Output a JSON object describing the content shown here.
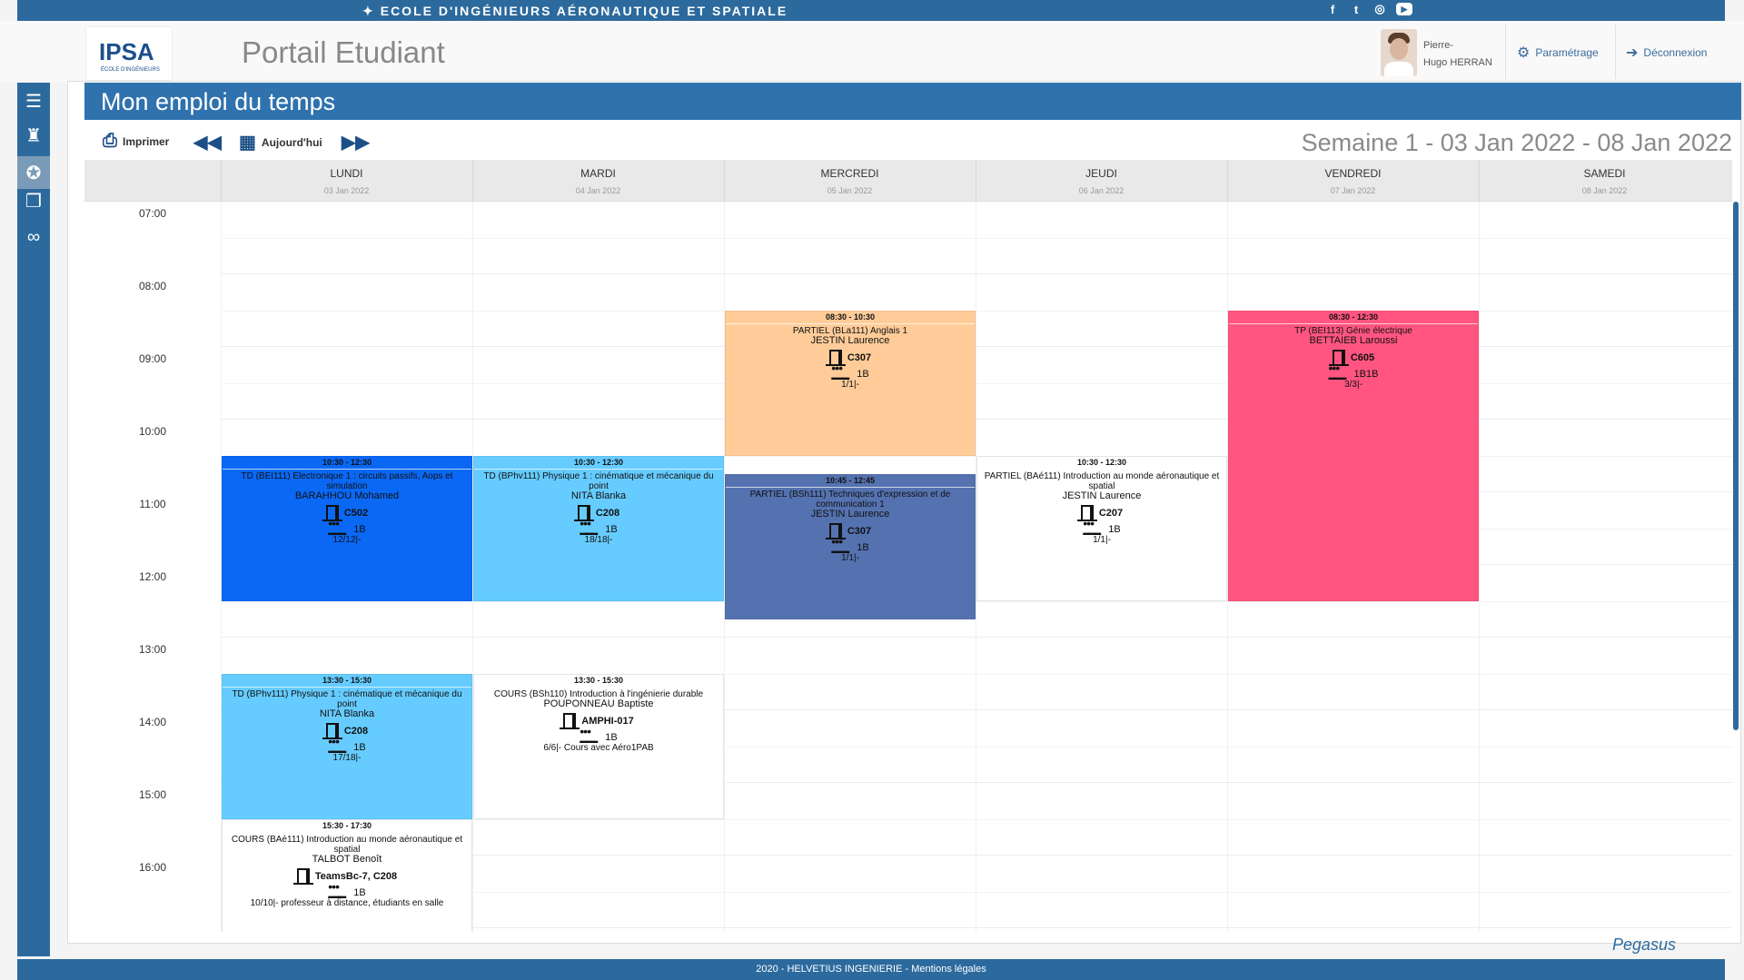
{
  "topbar": {
    "school_name": "ECOLE D'INGÉNIEURS AÉRONAUTIQUE ET SPATIALE",
    "social": [
      "f",
      "t",
      "ig",
      "yt"
    ]
  },
  "header": {
    "logo_text": "IPSA",
    "logo_sub": "ÉCOLE D'INGÉNIEURS",
    "portal_title": "Portail Etudiant",
    "user_first": "Pierre-",
    "user_last": "Hugo HERRAN",
    "settings_label": "Paramétrage",
    "logout_label": "Déconnexion"
  },
  "nav": {
    "icons": [
      "menu-icon",
      "graduate-icon",
      "certificate-icon",
      "documents-icon",
      "link-icon"
    ]
  },
  "page_title": "Mon emploi du temps",
  "toolbar": {
    "print_label": "Imprimer",
    "today_label": "Aujourd'hui",
    "week_title": "Semaine 1 - 03 Jan 2022 - 08 Jan 2022"
  },
  "days": [
    {
      "name": "LUNDI",
      "date": "03 Jan 2022"
    },
    {
      "name": "MARDI",
      "date": "04 Jan 2022"
    },
    {
      "name": "MERCREDI",
      "date": "05 Jan 2022"
    },
    {
      "name": "JEUDI",
      "date": "06 Jan 2022"
    },
    {
      "name": "VENDREDI",
      "date": "07 Jan 2022"
    },
    {
      "name": "SAMEDI",
      "date": "08 Jan 2022"
    }
  ],
  "hours": [
    "07:00",
    "08:00",
    "09:00",
    "10:00",
    "11:00",
    "12:00",
    "13:00",
    "14:00",
    "15:00",
    "16:00"
  ],
  "events": [
    {
      "day": 0,
      "start": 10.5,
      "end": 12.5,
      "color": "#0a68f5",
      "time": "10:30 - 12:30",
      "title": "TD (BEI111) Electronique 1 : circuits passifs, Aops et simulation",
      "teacher": "BARAHHOU Mohamed",
      "room": "C502",
      "group": "1B",
      "count": "12/12|-"
    },
    {
      "day": 1,
      "start": 10.5,
      "end": 12.5,
      "color": "#66ccff",
      "time": "10:30 - 12:30",
      "title": "TD (BPhv111) Physique 1 : cinématique et mécanique du point",
      "teacher": "NITA Blanka",
      "room": "C208",
      "group": "1B",
      "count": "18/18|-"
    },
    {
      "day": 2,
      "start": 8.5,
      "end": 10.5,
      "color": "#ffcc99",
      "time": "08:30 - 10:30",
      "title": "PARTIEL (BLa111) Anglais 1",
      "teacher": "JESTIN Laurence",
      "room": "C307",
      "group": "1B",
      "count": "1/1|-"
    },
    {
      "day": 2,
      "start": 10.75,
      "end": 12.75,
      "color": "#5572b0",
      "time": "10:45 - 12:45",
      "title": "PARTIEL (BSh111) Techniques d'expression et de communication 1",
      "teacher": "JESTIN Laurence",
      "room": "C307",
      "group": "1B",
      "count": "1/1|-"
    },
    {
      "day": 3,
      "start": 10.5,
      "end": 12.5,
      "color": "#ffffff",
      "time": "10:30 - 12:30",
      "title": "PARTIEL (BAé111) Introduction au monde aéronautique et spatial",
      "teacher": "JESTIN Laurence",
      "room": "C207",
      "group": "1B",
      "count": "1/1|-"
    },
    {
      "day": 4,
      "start": 8.5,
      "end": 12.5,
      "color": "#ff5580",
      "time": "08:30 - 12:30",
      "title": "TP (BEI113) Génie électrique",
      "teacher": "BETTAIEB Laroussi",
      "room": "C605",
      "group": "1B1B",
      "count": "3/3|-"
    },
    {
      "day": 0,
      "start": 13.5,
      "end": 15.5,
      "color": "#66ccff",
      "time": "13:30 - 15:30",
      "title": "TD (BPhv111) Physique 1 : cinématique et mécanique du point",
      "teacher": "NITA Blanka",
      "room": "C208",
      "group": "1B",
      "count": "17/18|-"
    },
    {
      "day": 1,
      "start": 13.5,
      "end": 15.5,
      "color": "#ffffff",
      "time": "13:30 - 15:30",
      "title": "COURS (BSh110) Introduction à l'ingénierie durable",
      "teacher": "POUPONNEAU Baptiste",
      "room": "AMPHI-017",
      "group": "1B",
      "count": "6/6|- Cours avec Aéro1PAB"
    },
    {
      "day": 0,
      "start": 15.5,
      "end": 17.5,
      "color": "#ffffff",
      "time": "15:30 - 17:30",
      "title": "COURS (BAé111) Introduction au monde aéronautique et spatial",
      "teacher": "TALBOT Benoît",
      "room": "TeamsBc-7, C208",
      "group": "1B",
      "count": "10/10|- professeur à distance, étudiants en salle"
    }
  ],
  "footer": {
    "text": "2020 - HELVETIUS INGENIERIE - Mentions légales",
    "brand": "Pegasus"
  }
}
